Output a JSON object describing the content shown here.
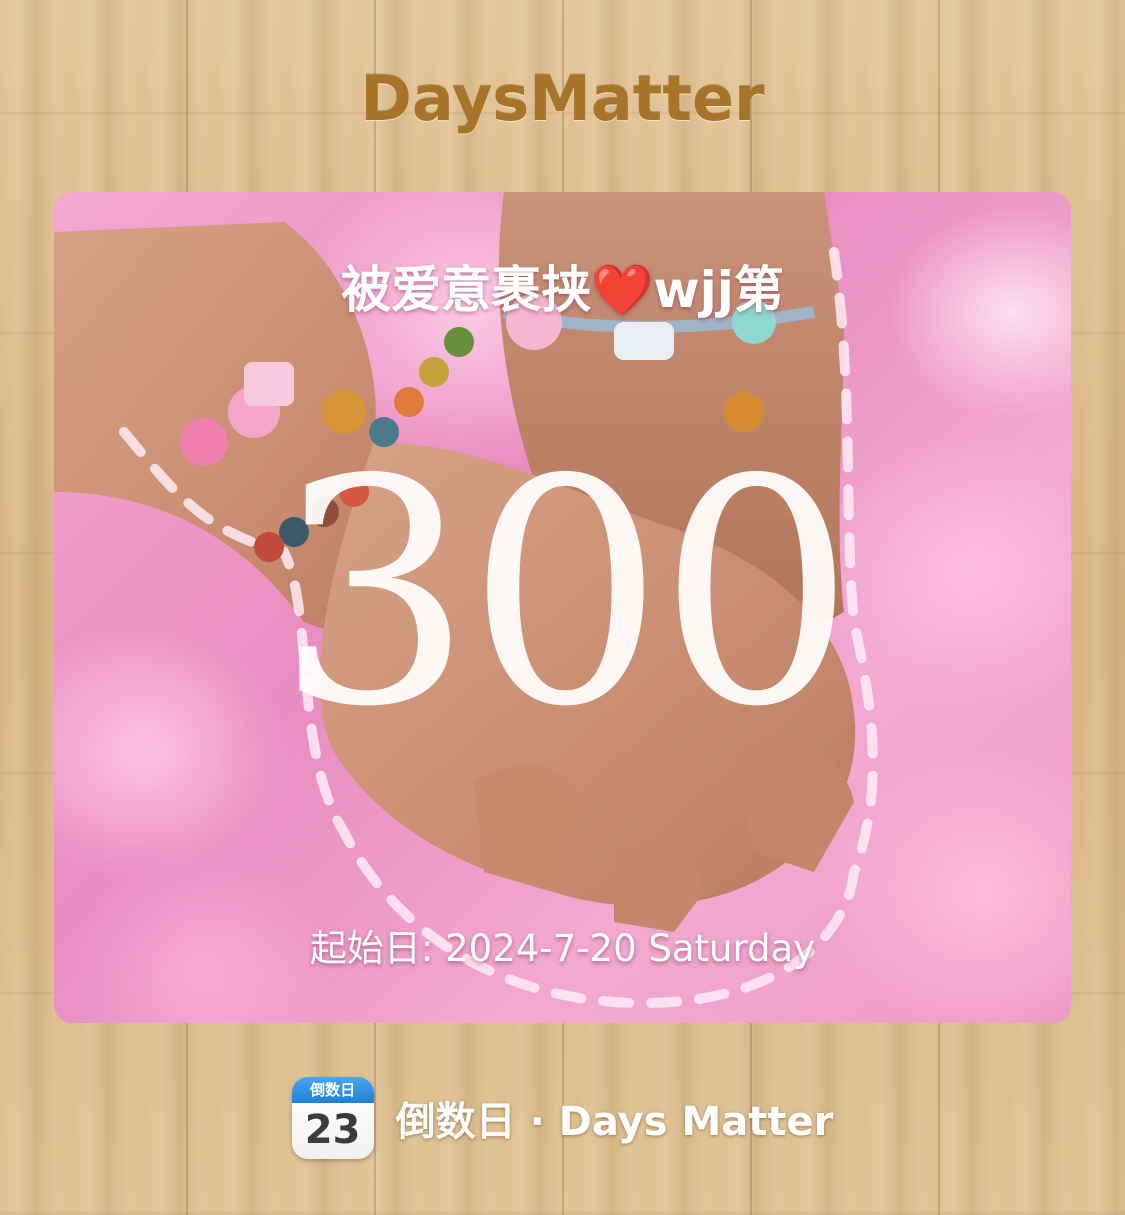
{
  "header": {
    "app_title": "DaysMatter"
  },
  "card": {
    "title_prefix": "被爱意裹挟",
    "title_heart": "❤️",
    "title_suffix": "wjj第",
    "day_count": "300",
    "start_date": "起始日: 2024-7-20 Saturday"
  },
  "footer": {
    "icon_header": "倒数日",
    "icon_number": "23",
    "label": "倒数日 · Days Matter"
  },
  "colors": {
    "title_gold": "#a7742a",
    "card_pink": "#f4a8cf",
    "heart_red": "#e5102a",
    "icon_blue": "#1e7fd4"
  },
  "icons": {
    "app_icon": "calendar-icon",
    "heart_icon": "heart-icon"
  }
}
